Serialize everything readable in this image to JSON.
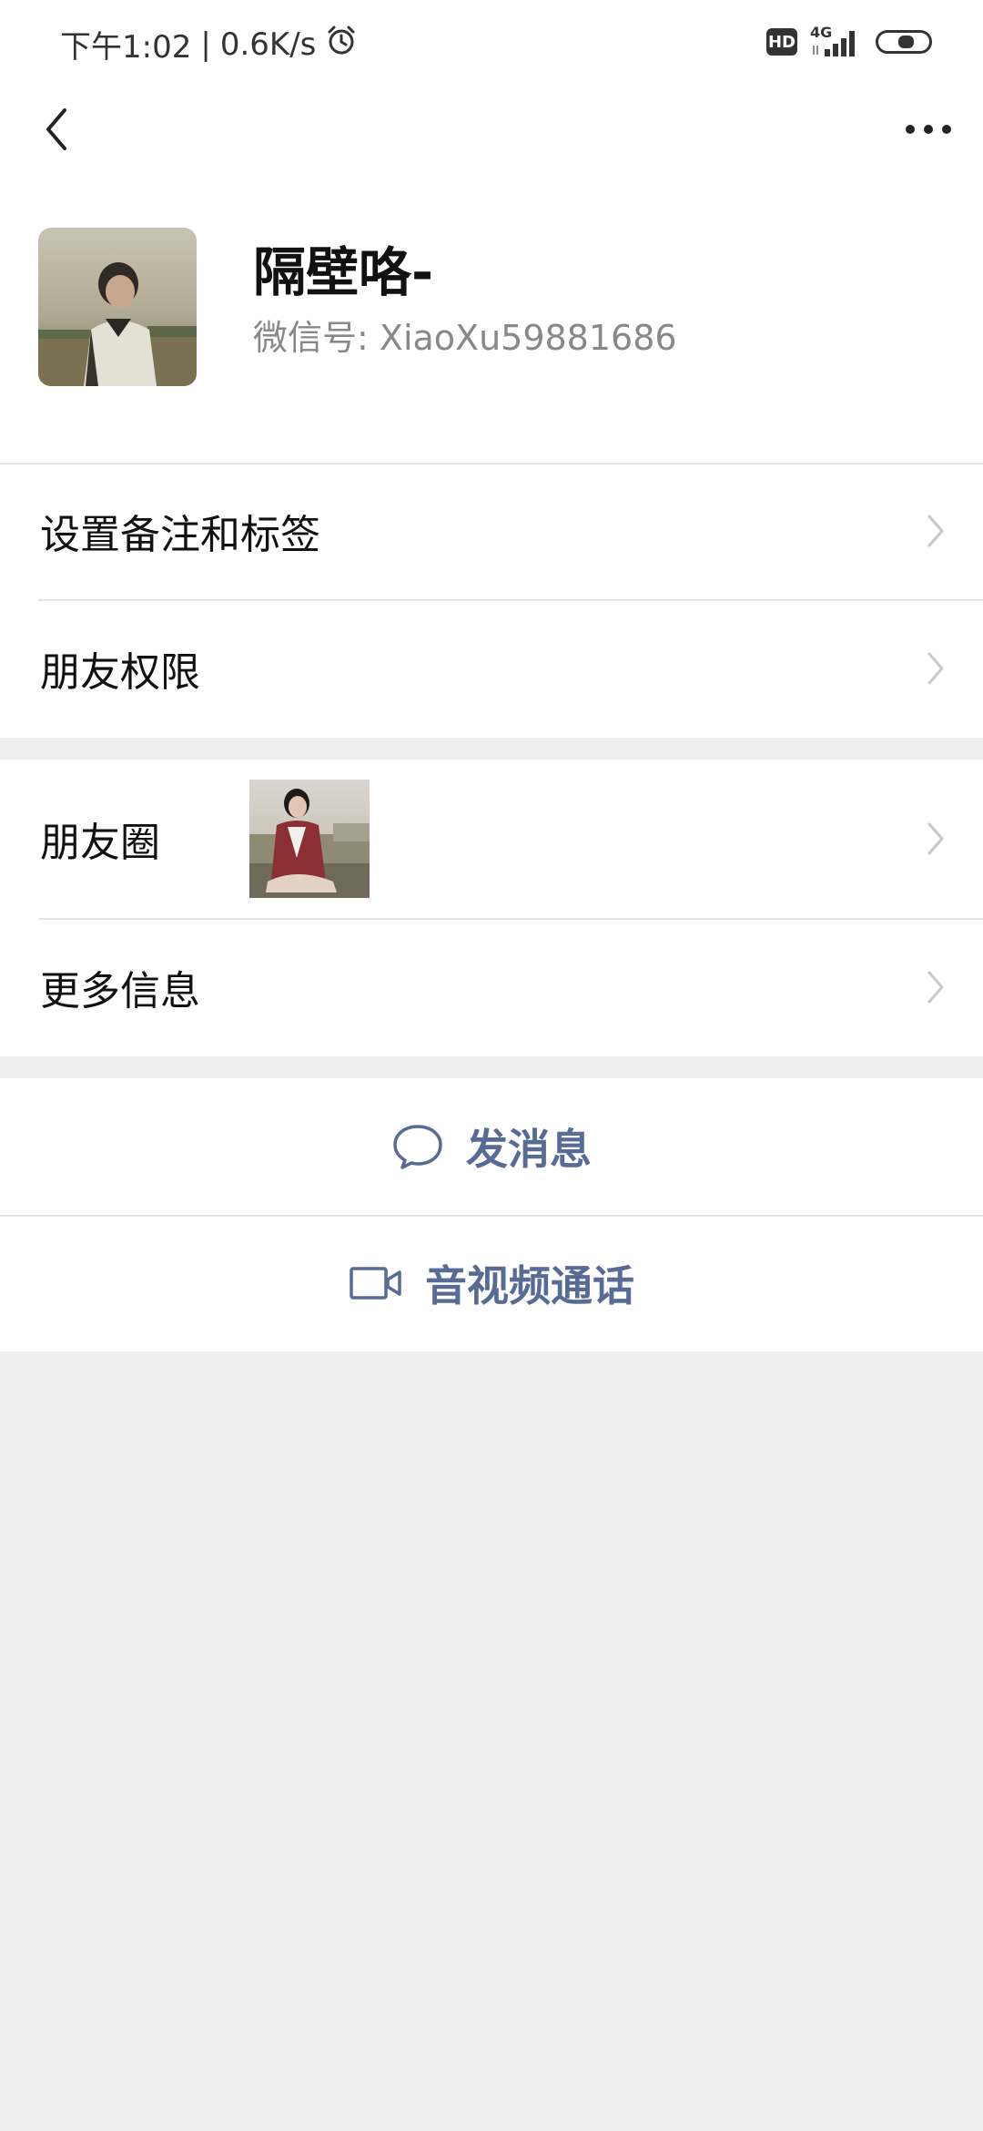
{
  "status_bar": {
    "time": "下午1:02",
    "separator": "|",
    "speed": "0.6K/s",
    "alarm_icon": "alarm-icon",
    "hd_label": "HD",
    "network_type": "4G",
    "signal_icon": "signal-icon",
    "battery_icon": "battery-icon",
    "battery_level": 0.55
  },
  "nav": {
    "back_icon": "chevron-left-icon",
    "more_icon": "more-dots-icon"
  },
  "profile": {
    "name": "隔壁咯-",
    "wechat_id_label": "微信号:",
    "wechat_id": "XiaoXu59881686"
  },
  "menu_group_1": {
    "items": [
      {
        "label": "设置备注和标签"
      },
      {
        "label": "朋友权限"
      }
    ]
  },
  "menu_group_2": {
    "items": [
      {
        "label": "朋友圈"
      },
      {
        "label": "更多信息"
      }
    ]
  },
  "actions": {
    "message_label": "发消息",
    "message_icon": "chat-bubble-icon",
    "call_label": "音视频通话",
    "call_icon": "video-camera-icon"
  },
  "colors": {
    "link_blue": "#576b95",
    "background": "#ededed",
    "surface": "#ffffff"
  }
}
